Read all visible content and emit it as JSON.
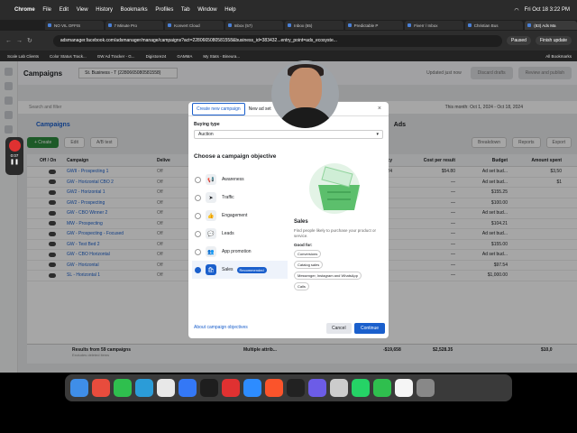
{
  "menubar": {
    "apple": "",
    "app": "Chrome",
    "items": [
      "File",
      "Edit",
      "View",
      "History",
      "Bookmarks",
      "Profiles",
      "Tab",
      "Window",
      "Help"
    ],
    "clock": "Fri Oct 18  3:22 PM"
  },
  "tabs": [
    "NO VIL OFFIS",
    "7 Minute Pro",
    "Konvert Cloud",
    "Inbox (57)",
    "Inbox (65)",
    "Predictable P",
    "Fiverr / Inbox",
    "Christian Bus",
    "IMS Publishin",
    "(83) Ads Ma"
  ],
  "address": {
    "url": "adsmanager.facebook.com/adsmanager/manage/campaigns?act=2280665080581558&business_id=383432...entry_point=ads_ecosyste...",
    "paused": "Paused",
    "finish_update": "Finish update"
  },
  "bookmarks": [
    "Scale Lab Clients",
    "Color Status Track...",
    "GW Ad Tracker - G...",
    "Digistore24",
    "GAMMA",
    "My Stats - Bineura..."
  ],
  "bookmarks_all": "All Bookmarks",
  "ads_manager": {
    "title": "Campaigns",
    "business": "St. Business - T (2280665080581558)",
    "updated": "Updated just now",
    "discard": "Discard drafts",
    "review": "Review and publish",
    "search": "Search and filter",
    "date_range": "This month: Oct 1, 2024 - Oct 18, 2024",
    "tab_campaigns": "Campaigns",
    "tab_ads": "Ads",
    "create": "+ Create",
    "edit": "Edit",
    "ab_test": "A/B test",
    "breakdown": "Breakdown",
    "reports": "Reports",
    "export": "Export",
    "columns": {
      "offon": "Off / On",
      "campaign": "Campaign",
      "deliv": "Delive",
      "freq": "quency",
      "cpr": "Cost per result",
      "budget": "Budget",
      "spent": "Amount spent"
    },
    "rows": [
      {
        "name": "GWII - Prospecting 1",
        "d": "Off",
        "f": "1.24",
        "c": "$54.80",
        "b": "Ad set bud...",
        "a": "$3,50"
      },
      {
        "name": "GW - Horizontal CBO 2",
        "d": "Off",
        "f": "",
        "c": "—",
        "b": "Ad set bud...",
        "a": "$1"
      },
      {
        "name": "GW2 - Horizontal 1",
        "d": "Off",
        "f": "",
        "c": "—",
        "b": "$155.25",
        "a": ""
      },
      {
        "name": "GW2 - Prospecting",
        "d": "Off",
        "f": "",
        "c": "—",
        "b": "$100.00",
        "a": ""
      },
      {
        "name": "GW - CBO Winner 2",
        "d": "Off",
        "f": "",
        "c": "—",
        "b": "Ad set bud...",
        "a": ""
      },
      {
        "name": "MW - Prospecting",
        "d": "Off",
        "f": "",
        "c": "—",
        "b": "$104.21",
        "a": ""
      },
      {
        "name": "GW - Prospecting - Focused",
        "d": "Off",
        "f": "",
        "c": "—",
        "b": "Ad set bud...",
        "a": ""
      },
      {
        "name": "GW - Test Bed 2",
        "d": "Off",
        "f": "",
        "c": "—",
        "b": "$155.00",
        "a": ""
      },
      {
        "name": "GW - CBO Horizontal",
        "d": "Off",
        "f": "",
        "c": "—",
        "b": "Ad set bud...",
        "a": ""
      },
      {
        "name": "GW - Horizontal",
        "d": "Off",
        "f": "",
        "c": "—",
        "b": "$97.54",
        "a": ""
      },
      {
        "name": "SL - Horizontal 1",
        "d": "Off",
        "f": "",
        "c": "—",
        "b": "$1,000.00",
        "a": ""
      }
    ],
    "results_label": "Results from 59 campaigns",
    "results_sub": "Excludes deleted items",
    "multiple": "Multiple attrib...",
    "results_num": "-$19,658",
    "results_cpr": "$2,528.35",
    "results_spent": "$10,0"
  },
  "modal": {
    "tab_create": "Create new campaign",
    "tab_new_ad_set": "New ad set",
    "close": "×",
    "buying_type_label": "Buying type",
    "buying_type": "Auction",
    "objective_title": "Choose a campaign objective",
    "objectives": [
      {
        "label": "Awareness",
        "icon": "📢"
      },
      {
        "label": "Traffic",
        "icon": "➤"
      },
      {
        "label": "Engagement",
        "icon": "👍"
      },
      {
        "label": "Leads",
        "icon": "💬"
      },
      {
        "label": "App promotion",
        "icon": "👥"
      },
      {
        "label": "Sales",
        "icon": "🛍"
      }
    ],
    "recommended": "Recommended",
    "detail_title": "Sales",
    "detail_text": "Find people likely to purchase your product or service.",
    "good_for": "Good for:",
    "chips": [
      "Conversions",
      "Catalog sales",
      "Messenger, Instagram and WhatsApp",
      "Calls"
    ],
    "about": "About campaign objectives",
    "cancel": "Cancel",
    "continue": "Continue"
  },
  "recorder": {
    "time": "0:07"
  }
}
